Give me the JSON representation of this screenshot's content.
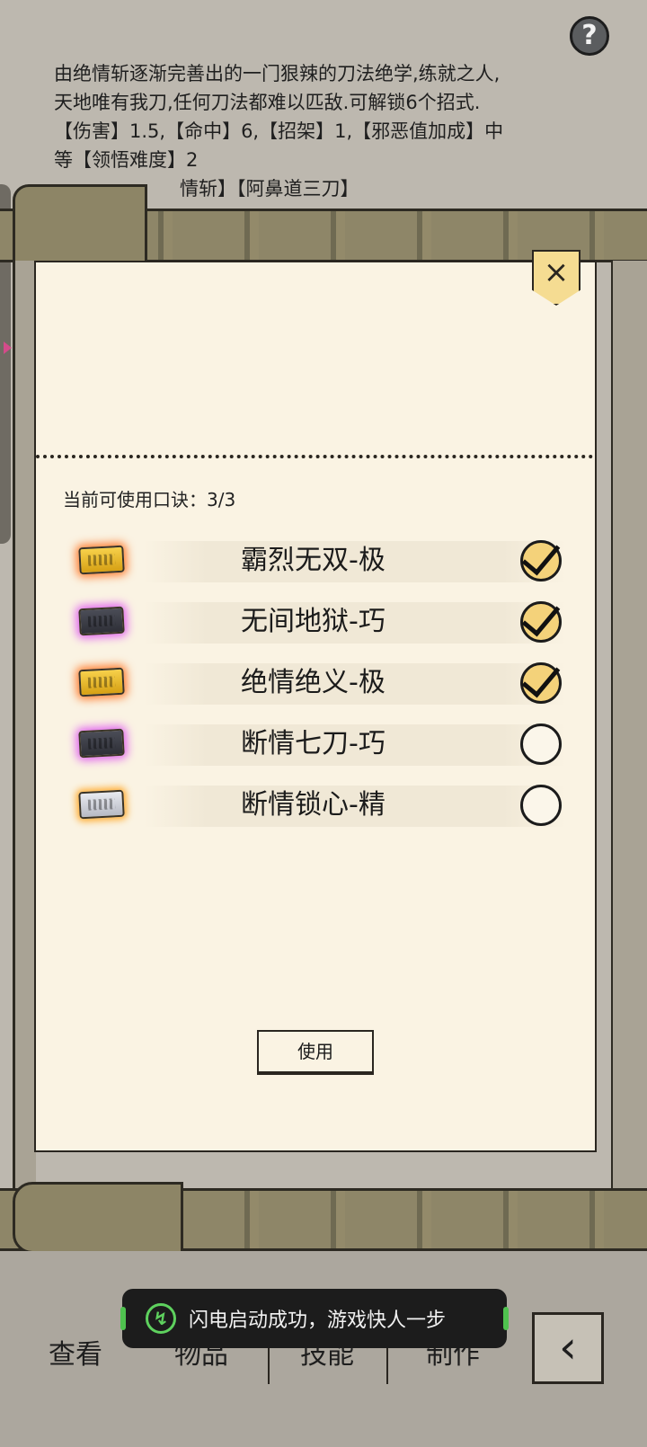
{
  "description": {
    "lines": [
      "由绝情斩逐渐完善出的一门狠辣的刀法绝学,练就之人,",
      "天地唯有我刀,任何刀法都难以匹敌.可解锁6个招式.",
      "【伤害】1.5,【命中】6,【招架】1,【邪恶值加成】中",
      "等【领悟难度】2",
      "情斩】【阿鼻道三刀】"
    ]
  },
  "help": {
    "label": "?"
  },
  "modal": {
    "close_label": "×",
    "count_label": "当前可使用口诀：3/3",
    "skills": [
      {
        "name": "霸烈无双-极",
        "icon": "scroll-gold",
        "checked": true
      },
      {
        "name": "无间地狱-巧",
        "icon": "scroll-purple",
        "checked": true
      },
      {
        "name": "绝情绝义-极",
        "icon": "scroll-gold",
        "checked": true
      },
      {
        "name": "断情七刀-巧",
        "icon": "scroll-purple",
        "checked": false
      },
      {
        "name": "断情锁心-精",
        "icon": "scroll-silver",
        "checked": false
      }
    ],
    "use_label": "使用"
  },
  "nav": {
    "items": [
      "查看",
      "物品",
      "技能",
      "制作"
    ],
    "back_icon": "back-arrow-icon"
  },
  "toast": {
    "text": "闪电启动成功，游戏快人一步",
    "icon": "lightning-icon"
  },
  "colors": {
    "panel": "#faf3e3",
    "accent_gold": "#f4d27a",
    "toast_green": "#5ed15e"
  }
}
